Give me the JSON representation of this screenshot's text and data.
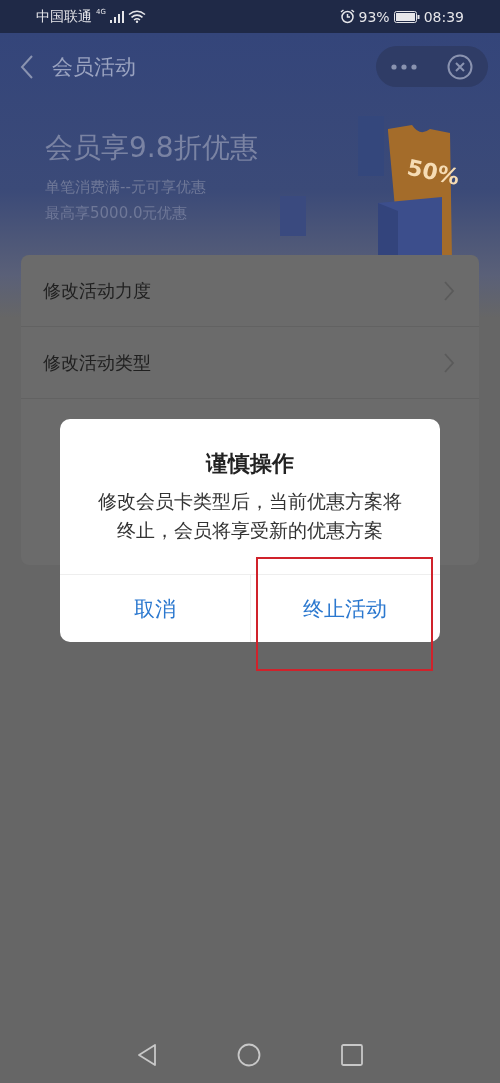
{
  "status_bar": {
    "carrier": "中国联通",
    "network": "4G",
    "battery": "93%",
    "time": "08:39"
  },
  "nav": {
    "title": "会员活动"
  },
  "banner": {
    "title": "会员享9.8折优惠",
    "lines": [
      "单笔消费满--元可享优惠",
      "最高享5000.0元优惠"
    ],
    "badge": "50%"
  },
  "menu": [
    {
      "label": "修改活动力度"
    },
    {
      "label": "修改活动类型"
    }
  ],
  "dialog": {
    "title": "谨慎操作",
    "message": "修改会员卡类型后，当前优惠方案将终止，会员将享受新的优惠方案",
    "buttons": [
      {
        "label": "取消",
        "highlighted": false
      },
      {
        "label": "终止活动",
        "highlighted": true
      }
    ]
  }
}
